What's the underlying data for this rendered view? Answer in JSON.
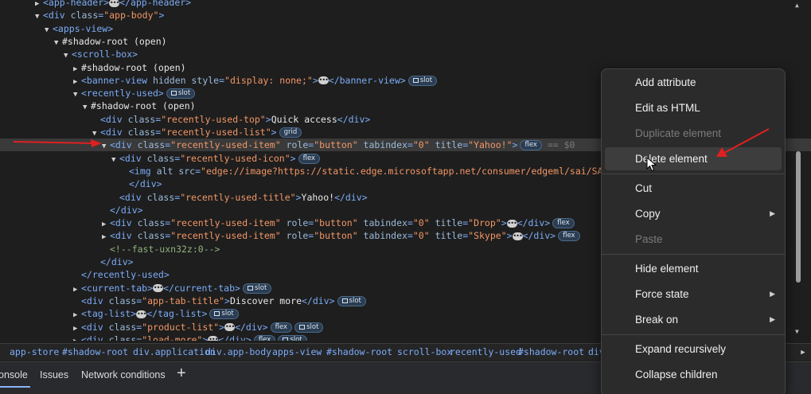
{
  "tree": {
    "rows": [
      {
        "indent": 56,
        "tri": "▶",
        "parts": [
          [
            "tag",
            "<app-header>"
          ],
          [
            "ellipsis",
            ""
          ],
          [
            "tag",
            "</app-header>"
          ]
        ]
      },
      {
        "indent": 56,
        "tri": "▼",
        "parts": [
          [
            "tag",
            "<div "
          ],
          [
            "attr",
            "class"
          ],
          [
            "tag",
            "="
          ],
          [
            "str",
            "\"app-body\""
          ],
          [
            "tag",
            ">"
          ]
        ]
      },
      {
        "indent": 68,
        "tri": "▼",
        "parts": [
          [
            "tag",
            "<apps-view>"
          ]
        ]
      },
      {
        "indent": 80,
        "tri": "▼",
        "parts": [
          [
            "txt",
            "#shadow-root (open)"
          ]
        ]
      },
      {
        "indent": 92,
        "tri": "▼",
        "parts": [
          [
            "tag",
            "<scroll-box>"
          ]
        ]
      },
      {
        "indent": 104,
        "tri": "▶",
        "parts": [
          [
            "txt",
            "#shadow-root (open)"
          ]
        ]
      },
      {
        "indent": 104,
        "tri": "▶",
        "parts": [
          [
            "tag",
            "<banner-view "
          ],
          [
            "attr",
            "hidden style"
          ],
          [
            "tag",
            "="
          ],
          [
            "str",
            "\"display: none;\""
          ],
          [
            "tag",
            ">"
          ],
          [
            "ellipsis",
            ""
          ],
          [
            "tag",
            "</banner-view>"
          ],
          [
            "badge",
            "slot"
          ]
        ]
      },
      {
        "indent": 104,
        "tri": "▼",
        "parts": [
          [
            "tag",
            "<recently-used>"
          ],
          [
            "badge",
            "slot"
          ]
        ]
      },
      {
        "indent": 116,
        "tri": "▼",
        "parts": [
          [
            "txt",
            "#shadow-root (open)"
          ]
        ]
      },
      {
        "indent": 128,
        "tri": "",
        "parts": [
          [
            "tag",
            "<div "
          ],
          [
            "attr",
            "class"
          ],
          [
            "tag",
            "="
          ],
          [
            "str",
            "\"recently-used-top\""
          ],
          [
            "tag",
            ">"
          ],
          [
            "txt",
            "Quick access"
          ],
          [
            "tag",
            "</div>"
          ]
        ]
      },
      {
        "indent": 128,
        "tri": "▼",
        "parts": [
          [
            "tag",
            "<div "
          ],
          [
            "attr",
            "class"
          ],
          [
            "tag",
            "="
          ],
          [
            "str",
            "\"recently-used-list\""
          ],
          [
            "tag",
            ">"
          ],
          [
            "badge",
            "grid"
          ]
        ]
      },
      {
        "indent": 140,
        "tri": "▼",
        "selected": true,
        "parts": [
          [
            "tag",
            "<div "
          ],
          [
            "attr",
            "class"
          ],
          [
            "tag",
            "="
          ],
          [
            "str",
            "\"recently-used-item\""
          ],
          [
            "attr",
            " role"
          ],
          [
            "tag",
            "="
          ],
          [
            "str",
            "\"button\""
          ],
          [
            "attr",
            " tabindex"
          ],
          [
            "tag",
            "="
          ],
          [
            "str",
            "\"0\""
          ],
          [
            "attr",
            " title"
          ],
          [
            "tag",
            "="
          ],
          [
            "str",
            "\"Yahoo!\""
          ],
          [
            "tag",
            ">"
          ],
          [
            "badge",
            "flex"
          ],
          [
            "dim",
            " == $0"
          ]
        ]
      },
      {
        "indent": 152,
        "tri": "▼",
        "parts": [
          [
            "tag",
            "<div "
          ],
          [
            "attr",
            "class"
          ],
          [
            "tag",
            "="
          ],
          [
            "str",
            "\"recently-used-icon\""
          ],
          [
            "tag",
            ">"
          ],
          [
            "badge",
            "flex"
          ]
        ]
      },
      {
        "indent": 164,
        "tri": "",
        "parts": [
          [
            "tag",
            "<img "
          ],
          [
            "attr",
            "alt src"
          ],
          [
            "tag",
            "="
          ],
          [
            "str",
            "\"edge://image?https://static.edge.microsoftapp.net/consumer/edgeml/sai/SAI_"
          ]
        ]
      },
      {
        "indent": 164,
        "tri": "",
        "parts": [
          [
            "tag",
            "</div>"
          ]
        ]
      },
      {
        "indent": 152,
        "tri": "",
        "parts": [
          [
            "tag",
            "<div "
          ],
          [
            "attr",
            "class"
          ],
          [
            "tag",
            "="
          ],
          [
            "str",
            "\"recently-used-title\""
          ],
          [
            "tag",
            ">"
          ],
          [
            "txt",
            "Yahoo!"
          ],
          [
            "tag",
            "</div>"
          ]
        ]
      },
      {
        "indent": 140,
        "tri": "",
        "parts": [
          [
            "tag",
            "</div>"
          ]
        ]
      },
      {
        "indent": 140,
        "tri": "▶",
        "parts": [
          [
            "tag",
            "<div "
          ],
          [
            "attr",
            "class"
          ],
          [
            "tag",
            "="
          ],
          [
            "str",
            "\"recently-used-item\""
          ],
          [
            "attr",
            " role"
          ],
          [
            "tag",
            "="
          ],
          [
            "str",
            "\"button\""
          ],
          [
            "attr",
            " tabindex"
          ],
          [
            "tag",
            "="
          ],
          [
            "str",
            "\"0\""
          ],
          [
            "attr",
            " title"
          ],
          [
            "tag",
            "="
          ],
          [
            "str",
            "\"Drop\""
          ],
          [
            "tag",
            ">"
          ],
          [
            "ellipsis",
            ""
          ],
          [
            "tag",
            "</div>"
          ],
          [
            "badge",
            "flex"
          ]
        ]
      },
      {
        "indent": 140,
        "tri": "▶",
        "parts": [
          [
            "tag",
            "<div "
          ],
          [
            "attr",
            "class"
          ],
          [
            "tag",
            "="
          ],
          [
            "str",
            "\"recently-used-item\""
          ],
          [
            "attr",
            " role"
          ],
          [
            "tag",
            "="
          ],
          [
            "str",
            "\"button\""
          ],
          [
            "attr",
            " tabindex"
          ],
          [
            "tag",
            "="
          ],
          [
            "str",
            "\"0\""
          ],
          [
            "attr",
            " title"
          ],
          [
            "tag",
            "="
          ],
          [
            "str",
            "\"Skype\""
          ],
          [
            "tag",
            ">"
          ],
          [
            "ellipsis",
            ""
          ],
          [
            "tag",
            "</div>"
          ],
          [
            "badge",
            "flex"
          ]
        ]
      },
      {
        "indent": 140,
        "tri": "",
        "parts": [
          [
            "comment",
            "<!--fast-uxn32z:0-->"
          ]
        ]
      },
      {
        "indent": 128,
        "tri": "",
        "parts": [
          [
            "tag",
            "</div>"
          ]
        ]
      },
      {
        "indent": 104,
        "tri": "",
        "parts": [
          [
            "tag",
            "</recently-used>"
          ]
        ]
      },
      {
        "indent": 104,
        "tri": "▶",
        "parts": [
          [
            "tag",
            "<current-tab>"
          ],
          [
            "ellipsis",
            ""
          ],
          [
            "tag",
            "</current-tab>"
          ],
          [
            "badge",
            "slot"
          ]
        ]
      },
      {
        "indent": 104,
        "tri": "",
        "parts": [
          [
            "tag",
            "<div "
          ],
          [
            "attr",
            "class"
          ],
          [
            "tag",
            "="
          ],
          [
            "str",
            "\"app-tab-title\""
          ],
          [
            "tag",
            ">"
          ],
          [
            "txt",
            "Discover more"
          ],
          [
            "tag",
            "</div>"
          ],
          [
            "badge",
            "slot"
          ]
        ]
      },
      {
        "indent": 104,
        "tri": "▶",
        "parts": [
          [
            "tag",
            "<tag-list>"
          ],
          [
            "ellipsis",
            ""
          ],
          [
            "tag",
            "</tag-list>"
          ],
          [
            "badge",
            "slot"
          ]
        ]
      },
      {
        "indent": 104,
        "tri": "▶",
        "parts": [
          [
            "tag",
            "<div "
          ],
          [
            "attr",
            "class"
          ],
          [
            "tag",
            "="
          ],
          [
            "str",
            "\"product-list\""
          ],
          [
            "tag",
            ">"
          ],
          [
            "ellipsis",
            ""
          ],
          [
            "tag",
            "</div>"
          ],
          [
            "badge",
            "flex"
          ],
          [
            "badge",
            "slot"
          ]
        ]
      },
      {
        "indent": 104,
        "tri": "▶",
        "parts": [
          [
            "tag",
            "<div "
          ],
          [
            "attr",
            "class"
          ],
          [
            "tag",
            "="
          ],
          [
            "str",
            "\"load-more\""
          ],
          [
            "tag",
            ">"
          ],
          [
            "ellipsis",
            ""
          ],
          [
            "tag",
            "</div>"
          ],
          [
            "badge",
            "flex"
          ],
          [
            "badge",
            "slot"
          ]
        ]
      }
    ]
  },
  "breadcrumb": [
    "app-store",
    "#shadow-root",
    "div.application",
    "div.app-body",
    "apps-view",
    "#shadow-root",
    "scroll-box",
    "recently-used",
    "#shadow-root",
    "div"
  ],
  "drawer": {
    "tabs": [
      "onsole",
      "Issues",
      "Network conditions"
    ],
    "add": "+"
  },
  "menu": {
    "items": [
      {
        "label": "Add attribute",
        "disabled": false,
        "submenu": false,
        "group": 0
      },
      {
        "label": "Edit as HTML",
        "disabled": false,
        "submenu": false,
        "group": 0
      },
      {
        "label": "Duplicate element",
        "disabled": true,
        "submenu": false,
        "group": 0
      },
      {
        "label": "Delete element",
        "disabled": false,
        "submenu": false,
        "group": 0,
        "hover": true
      },
      {
        "label": "Cut",
        "disabled": false,
        "submenu": false,
        "group": 1
      },
      {
        "label": "Copy",
        "disabled": false,
        "submenu": true,
        "group": 1
      },
      {
        "label": "Paste",
        "disabled": true,
        "submenu": false,
        "group": 1
      },
      {
        "label": "Hide element",
        "disabled": false,
        "submenu": false,
        "group": 2
      },
      {
        "label": "Force state",
        "disabled": false,
        "submenu": true,
        "group": 2
      },
      {
        "label": "Break on",
        "disabled": false,
        "submenu": true,
        "group": 2
      },
      {
        "label": "Expand recursively",
        "disabled": false,
        "submenu": false,
        "group": 3
      },
      {
        "label": "Collapse children",
        "disabled": false,
        "submenu": false,
        "group": 3
      }
    ]
  },
  "colors": {
    "annotation_arrow": "#e02020",
    "selected_row": "#3a3a3a",
    "accent": "#8ab4f8"
  },
  "icons": [
    "triangle-expand-icon",
    "ellipsis-icon",
    "slot-icon",
    "chevron-right-icon",
    "plus-icon",
    "mouse-cursor-icon",
    "scroll-up-icon",
    "scroll-down-icon"
  ]
}
